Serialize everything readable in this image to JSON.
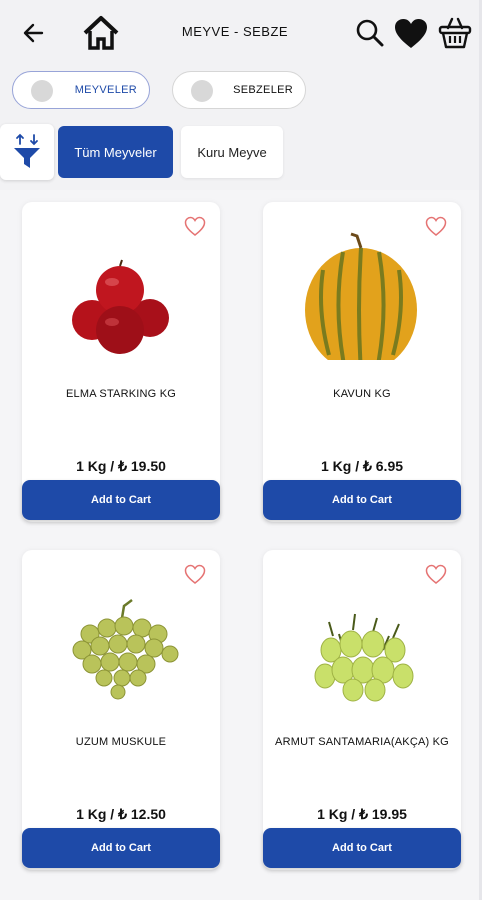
{
  "header": {
    "title": "MEYVE - SEBZE",
    "icons": [
      "back-arrow-icon",
      "home-icon",
      "search-icon",
      "heart-icon",
      "basket-icon"
    ]
  },
  "categories": [
    {
      "label": "MEYVELER",
      "icon": "fruit-icon",
      "active": true
    },
    {
      "label": "SEBZELER",
      "icon": "vegetable-icon",
      "active": false
    }
  ],
  "filters": {
    "icon": "funnel-filter-icon",
    "chips": [
      {
        "label": "Tüm Meyveler",
        "active": true
      },
      {
        "label": "Kuru Meyve",
        "active": false
      }
    ]
  },
  "products": [
    {
      "name": "ELMA STARKING KG",
      "price": "1 Kg / ₺ 19.50",
      "button": "Add to Cart",
      "image": "red-apples-image"
    },
    {
      "name": "KAVUN KG",
      "price": "1 Kg / ₺ 6.95",
      "button": "Add to Cart",
      "image": "melon-image"
    },
    {
      "name": "UZUM MUSKULE",
      "price": "1 Kg / ₺ 12.50",
      "button": "Add to Cart",
      "image": "green-grapes-image"
    },
    {
      "name": "ARMUT SANTAMARIA(AKÇA) KG",
      "price": "1 Kg / ₺ 19.95",
      "button": "Add to Cart",
      "image": "pears-image"
    }
  ],
  "colors": {
    "primary": "#1e4aa8",
    "favorite_outline": "#e57373",
    "background": "#f5f5f7"
  }
}
